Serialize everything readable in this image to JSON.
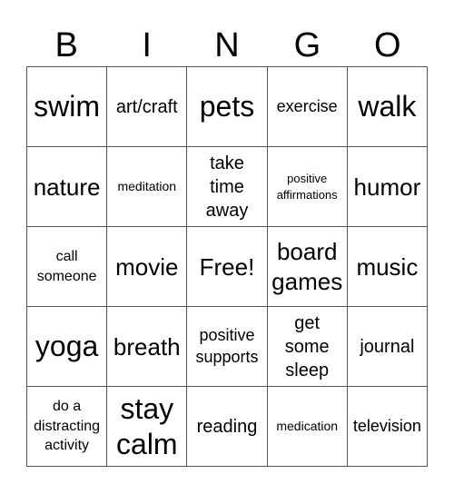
{
  "title_letters": [
    "B",
    "I",
    "N",
    "G",
    "O"
  ],
  "cells": [
    [
      "swim",
      "art/craft",
      "pets",
      "exercise",
      "walk"
    ],
    [
      "nature",
      "meditation",
      "take time away",
      "positive affirmations",
      "humor"
    ],
    [
      "call someone",
      "movie",
      "Free!",
      "board games",
      "music"
    ],
    [
      "yoga",
      "breath",
      "positive supports",
      "get some sleep",
      "journal"
    ],
    [
      "do a distracting activity",
      "stay calm",
      "reading",
      "medication",
      "television"
    ]
  ]
}
